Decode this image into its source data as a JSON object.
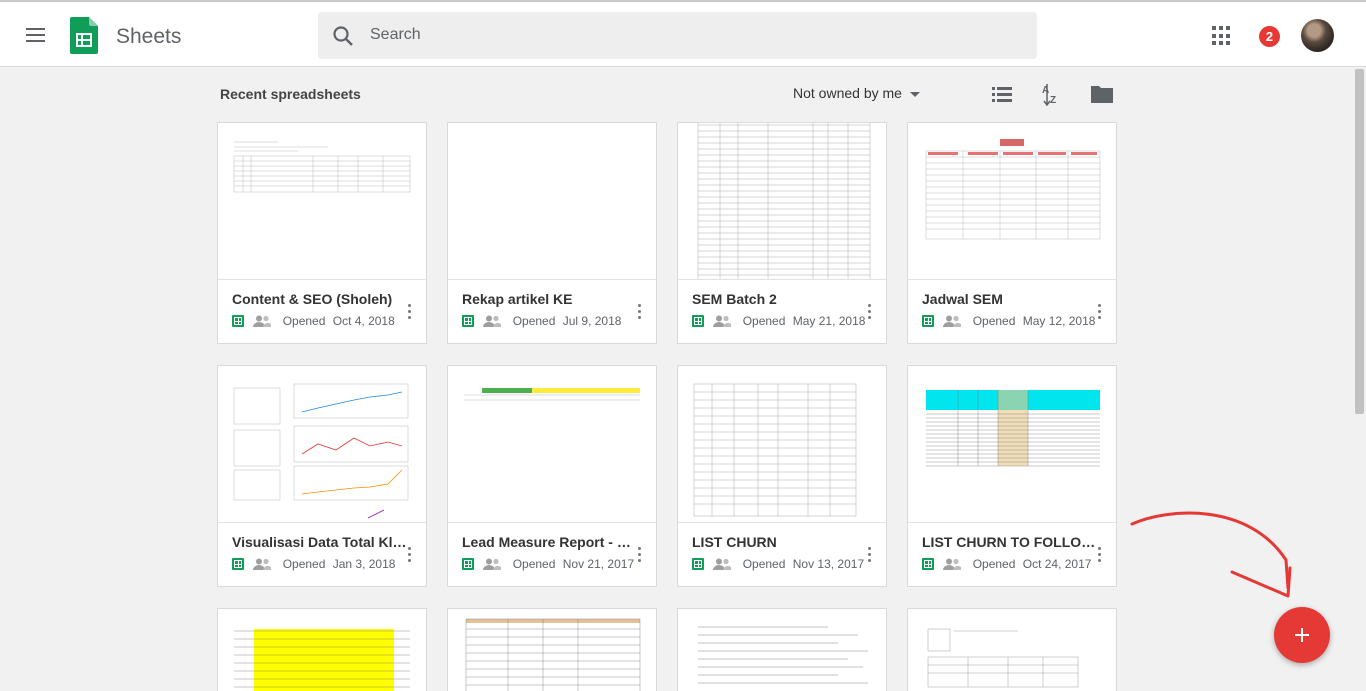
{
  "header": {
    "app_title": "Sheets",
    "search_placeholder": "Search",
    "notifications_count": "2"
  },
  "toolbar": {
    "section_title": "Recent spreadsheets",
    "owner_filter": "Not owned by me",
    "list_view_icon": "list-icon",
    "sort_icon": "sort-az-icon",
    "folder_icon": "folder-icon"
  },
  "cards": [
    {
      "name": "Content & SEO (Sholeh)",
      "opened_label": "Opened",
      "opened_date": "Oct 4, 2018"
    },
    {
      "name": "Rekap artikel KE",
      "opened_label": "Opened",
      "opened_date": "Jul 9, 2018"
    },
    {
      "name": "SEM Batch 2",
      "opened_label": "Opened",
      "opened_date": "May 21, 2018"
    },
    {
      "name": "Jadwal SEM",
      "opened_label": "Opened",
      "opened_date": "May 12, 2018"
    },
    {
      "name": "Visualisasi Data Total Klik...",
      "opened_label": "Opened",
      "opened_date": "Jan 3, 2018"
    },
    {
      "name": "Lead Measure Report - Fa...",
      "opened_label": "Opened",
      "opened_date": "Nov 21, 2017"
    },
    {
      "name": "LIST CHURN",
      "opened_label": "Opened",
      "opened_date": "Nov 13, 2017"
    },
    {
      "name": "LIST CHURN TO FOLLOW ...",
      "opened_label": "Opened",
      "opened_date": "Oct 24, 2017"
    }
  ],
  "fab_icon": "plus-icon",
  "colors": {
    "sheets_green": "#0f9d58",
    "fab_red": "#e53935",
    "annotation_red": "#e53935"
  }
}
